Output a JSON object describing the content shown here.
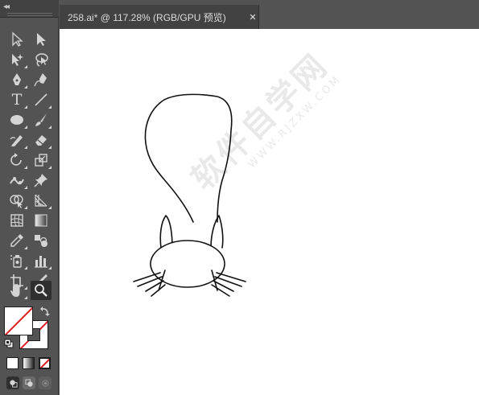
{
  "document": {
    "tab_label": "258.ai* @ 117.28% (RGB/GPU 预览)",
    "close_symbol": "✕"
  },
  "toolbar": {
    "collapse_symbol": "◂◂",
    "type_tool_glyph": "T",
    "tools": [
      "selection-tool",
      "direct-selection-tool",
      "magic-wand-tool",
      "lasso-tool",
      "pen-tool",
      "curvature-tool",
      "type-tool",
      "line-segment-tool",
      "ellipse-tool",
      "paintbrush-tool",
      "shaper-tool",
      "eraser-tool",
      "rotate-tool",
      "scale-tool",
      "puppet-warp-tool",
      "pin-tool",
      "shape-builder-tool",
      "perspective-grid-tool",
      "mesh-tool",
      "gradient-tool",
      "eyedropper-tool",
      "blend-tool",
      "symbol-sprayer-tool",
      "column-graph-tool",
      "artboard-tool",
      "slice-tool",
      "hand-tool",
      "zoom-tool"
    ],
    "active_tool": "zoom-tool",
    "fill": "none",
    "stroke": "none"
  },
  "watermark": {
    "main": "软件自学网",
    "url": "WWW.RJZXW.COM"
  },
  "colors": {
    "ui_dark": "#535353",
    "tab_bg": "#424242",
    "canvas": "#ffffff",
    "none_slash": "#e01b24",
    "icon": "#d4d4d4"
  }
}
